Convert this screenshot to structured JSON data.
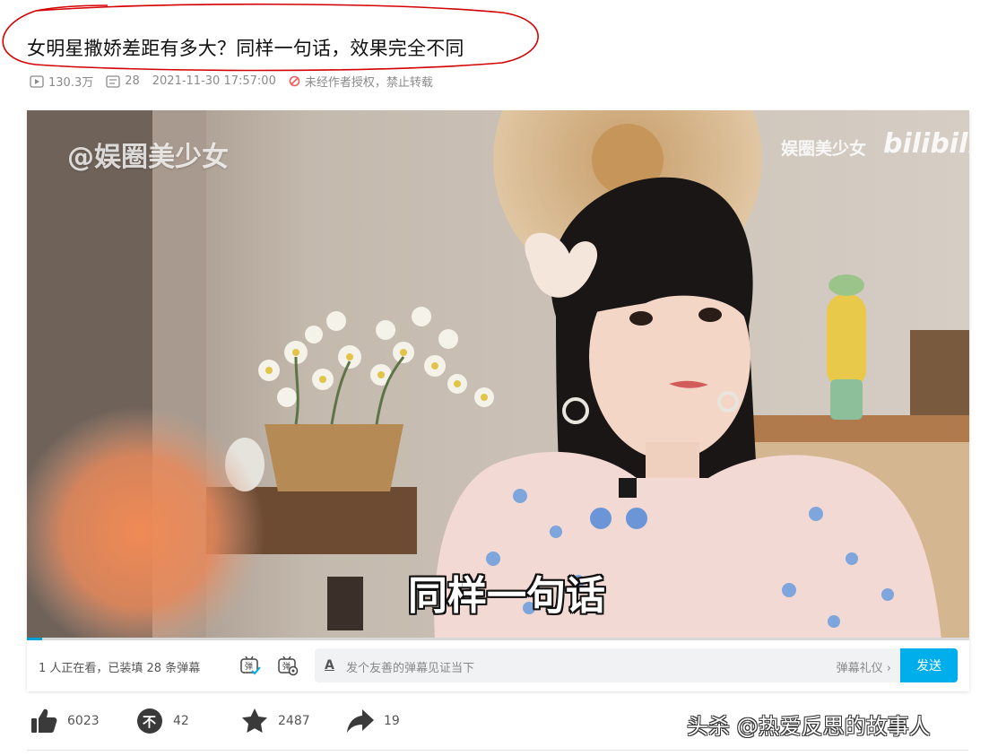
{
  "article": {
    "title": "女明星撒娇差距有多大？同样一句话，效果完全不同"
  },
  "meta": {
    "play_count": "130.3万",
    "comment_count": "28",
    "publish_time": "2021-11-30 17:57:00",
    "copyright_notice": "未经作者授权，禁止转载"
  },
  "video": {
    "watermark_left": "@娱圈美少女",
    "watermark_right": "娱圈美少女",
    "logo_text": "bilibili",
    "subtitle": "同样一句话",
    "progress_fraction": 0.016
  },
  "danmaku_bar": {
    "viewers_text": "1 人正在看，已装填 28 条弹幕",
    "input_placeholder": "发个友善的弹幕见证当下",
    "etiquette_link": "弹幕礼仪 ›",
    "send_label": "发送"
  },
  "actions": {
    "like_count": "6023",
    "dislike_count": "42",
    "favorite_count": "2487",
    "share_count": "19"
  },
  "source_watermark": "头杀 @热爱反思的故事人",
  "colors": {
    "accent": "#00aeec",
    "annotation": "#d40000"
  }
}
